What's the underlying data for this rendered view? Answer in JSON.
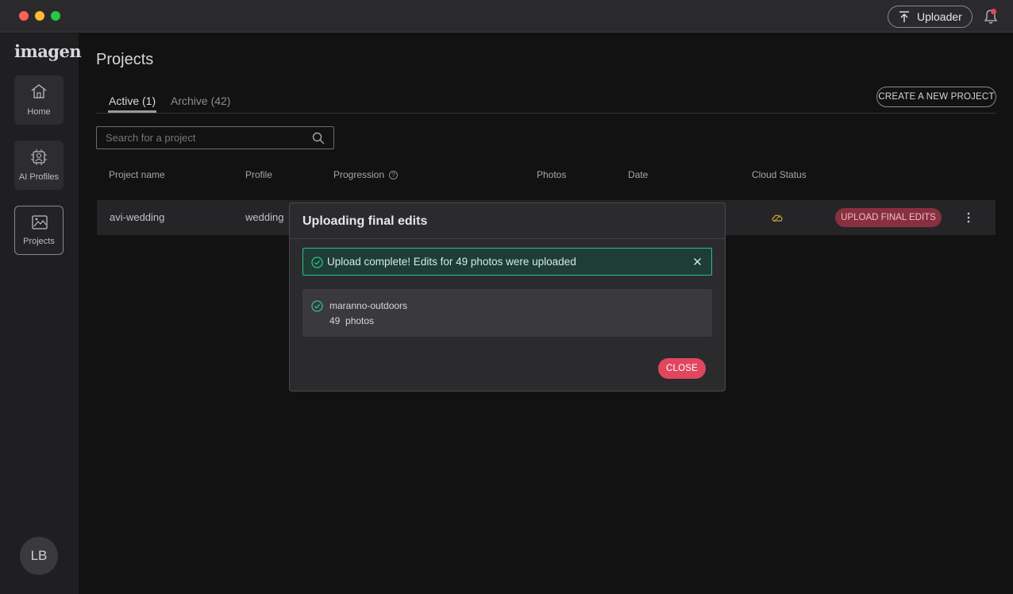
{
  "titlebar": {
    "uploader_label": "Uploader"
  },
  "sidebar": {
    "logo": "imagen",
    "items": [
      {
        "label": "Home",
        "icon": "home-icon"
      },
      {
        "label": "AI Profiles",
        "icon": "ai-profile-icon"
      },
      {
        "label": "Projects",
        "icon": "projects-icon",
        "active": true
      }
    ],
    "avatar_initials": "LB"
  },
  "main": {
    "title": "Projects",
    "tabs": [
      {
        "label": "Active (1)",
        "active": true
      },
      {
        "label": "Archive (42)",
        "active": false
      }
    ],
    "create_button": "CREATE A NEW PROJECT",
    "search": {
      "placeholder": "Search for a project"
    },
    "columns": [
      "Project name",
      "Profile",
      "Progression",
      "Photos",
      "Date",
      "Cloud Status"
    ],
    "rows": [
      {
        "name": "avi-wedding",
        "profile": "wedding",
        "action": "UPLOAD FINAL EDITS"
      }
    ]
  },
  "modal": {
    "title": "Uploading final edits",
    "alert_text": "Upload complete! Edits for 49 photos were uploaded",
    "project_name": "maranno-outdoors",
    "project_photos": "49  photos",
    "close_label": "CLOSE"
  },
  "colors": {
    "accent": "#e0475f",
    "success": "#2fbf8a",
    "background": "#121212"
  }
}
